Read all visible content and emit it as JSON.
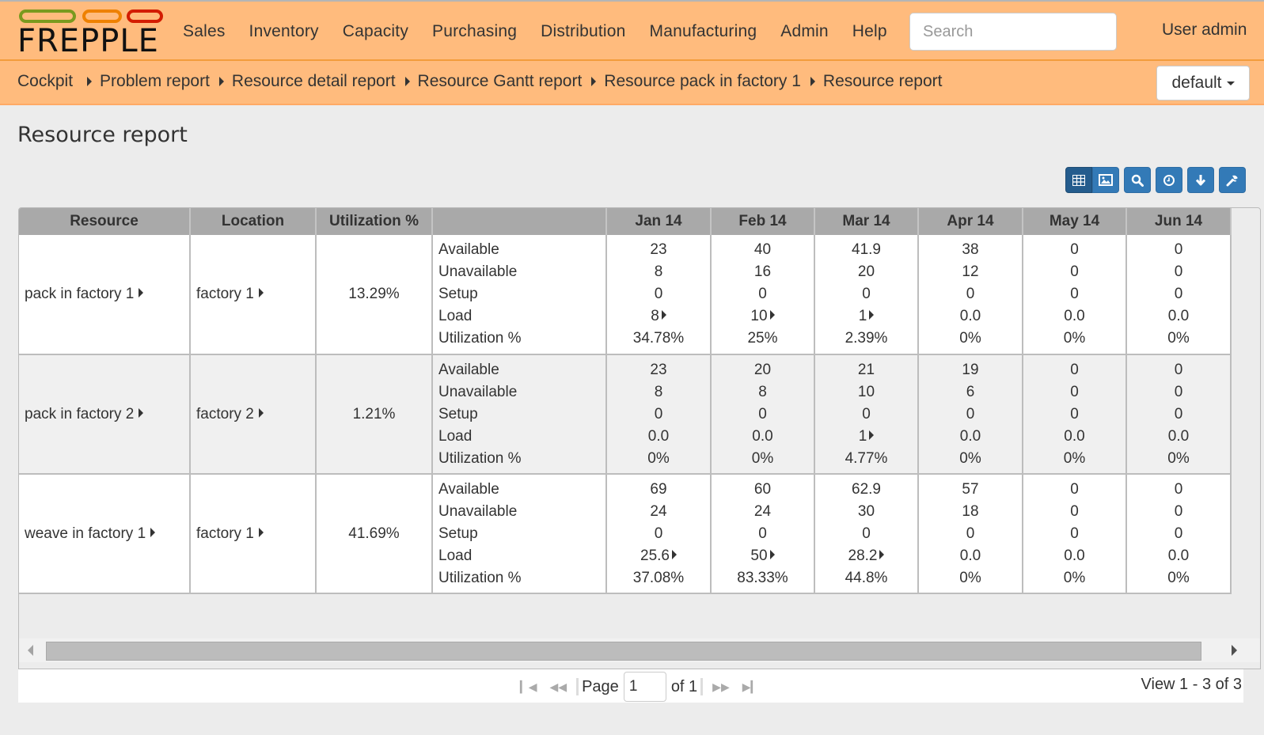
{
  "app": {
    "logo_text": "FREPPLE",
    "logo_colors": [
      "#7a9a1e",
      "#ee8100",
      "#d31c00"
    ]
  },
  "nav": {
    "items": [
      "Sales",
      "Inventory",
      "Capacity",
      "Purchasing",
      "Distribution",
      "Manufacturing",
      "Admin",
      "Help"
    ],
    "search_placeholder": "Search",
    "user_label": "User admin"
  },
  "breadcrumbs": [
    "Cockpit",
    "Problem report",
    "Resource detail report",
    "Resource Gantt report",
    "Resource pack in factory 1",
    "Resource report"
  ],
  "scenario": {
    "label": "default"
  },
  "page": {
    "title": "Resource report"
  },
  "toolbar": {
    "buttons": [
      "table-view",
      "graph-view",
      "filter",
      "time-buckets",
      "export",
      "configure"
    ],
    "accent": "#337ab7"
  },
  "table": {
    "headers": [
      "Resource",
      "Location",
      "Utilization %",
      "",
      "Jan 14",
      "Feb 14",
      "Mar 14",
      "Apr 14",
      "May 14",
      "Jun 14"
    ],
    "row_labels": [
      "Available",
      "Unavailable",
      "Setup",
      "Load",
      "Utilization %"
    ],
    "rows": [
      {
        "resource": "pack in factory 1",
        "location": "factory 1",
        "utilization": "13.29%",
        "periods": [
          {
            "available": "23",
            "unavailable": "8",
            "setup": "0",
            "load": "8",
            "load_link": true,
            "utilization": "34.78%"
          },
          {
            "available": "40",
            "unavailable": "16",
            "setup": "0",
            "load": "10",
            "load_link": true,
            "utilization": "25%"
          },
          {
            "available": "41.9",
            "unavailable": "20",
            "setup": "0",
            "load": "1",
            "load_link": true,
            "utilization": "2.39%"
          },
          {
            "available": "38",
            "unavailable": "12",
            "setup": "0",
            "load": "0.0",
            "load_link": false,
            "utilization": "0%"
          },
          {
            "available": "0",
            "unavailable": "0",
            "setup": "0",
            "load": "0.0",
            "load_link": false,
            "utilization": "0%"
          },
          {
            "available": "0",
            "unavailable": "0",
            "setup": "0",
            "load": "0.0",
            "load_link": false,
            "utilization": "0%"
          }
        ]
      },
      {
        "resource": "pack in factory 2",
        "location": "factory 2",
        "utilization": "1.21%",
        "periods": [
          {
            "available": "23",
            "unavailable": "8",
            "setup": "0",
            "load": "0.0",
            "load_link": false,
            "utilization": "0%"
          },
          {
            "available": "20",
            "unavailable": "8",
            "setup": "0",
            "load": "0.0",
            "load_link": false,
            "utilization": "0%"
          },
          {
            "available": "21",
            "unavailable": "10",
            "setup": "0",
            "load": "1",
            "load_link": true,
            "utilization": "4.77%"
          },
          {
            "available": "19",
            "unavailable": "6",
            "setup": "0",
            "load": "0.0",
            "load_link": false,
            "utilization": "0%"
          },
          {
            "available": "0",
            "unavailable": "0",
            "setup": "0",
            "load": "0.0",
            "load_link": false,
            "utilization": "0%"
          },
          {
            "available": "0",
            "unavailable": "0",
            "setup": "0",
            "load": "0.0",
            "load_link": false,
            "utilization": "0%"
          }
        ]
      },
      {
        "resource": "weave in factory 1",
        "location": "factory 1",
        "utilization": "41.69%",
        "periods": [
          {
            "available": "69",
            "unavailable": "24",
            "setup": "0",
            "load": "25.6",
            "load_link": true,
            "utilization": "37.08%"
          },
          {
            "available": "60",
            "unavailable": "24",
            "setup": "0",
            "load": "50",
            "load_link": true,
            "utilization": "83.33%"
          },
          {
            "available": "62.9",
            "unavailable": "30",
            "setup": "0",
            "load": "28.2",
            "load_link": true,
            "utilization": "44.8%"
          },
          {
            "available": "57",
            "unavailable": "18",
            "setup": "0",
            "load": "0.0",
            "load_link": false,
            "utilization": "0%"
          },
          {
            "available": "0",
            "unavailable": "0",
            "setup": "0",
            "load": "0.0",
            "load_link": false,
            "utilization": "0%"
          },
          {
            "available": "0",
            "unavailable": "0",
            "setup": "0",
            "load": "0.0",
            "load_link": false,
            "utilization": "0%"
          }
        ]
      }
    ]
  },
  "pager": {
    "page_label": "Page",
    "page_value": "1",
    "of_label": "of 1",
    "view_info": "View 1 - 3 of 3"
  }
}
